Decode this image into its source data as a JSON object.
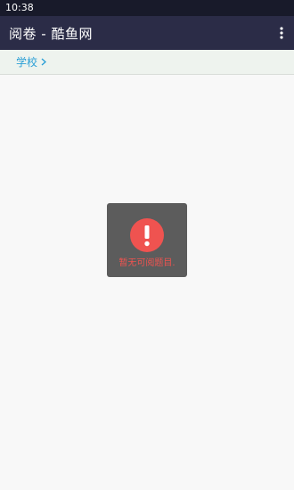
{
  "status_bar": {
    "time": "10:38"
  },
  "app_bar": {
    "title": "阅卷 - 酷鱼网",
    "menu_icon": "more-vert-icon"
  },
  "breadcrumb": {
    "label": "学校",
    "icon": "chevron-right-icon"
  },
  "toast": {
    "icon": "exclamation-icon",
    "message": "暂无可阅题目.",
    "icon_color": "#ef5350"
  },
  "colors": {
    "app_bar": "#2b2c47",
    "status_bar": "#181a2a",
    "link": "#2a9fd6",
    "background": "#f8f8f8"
  }
}
